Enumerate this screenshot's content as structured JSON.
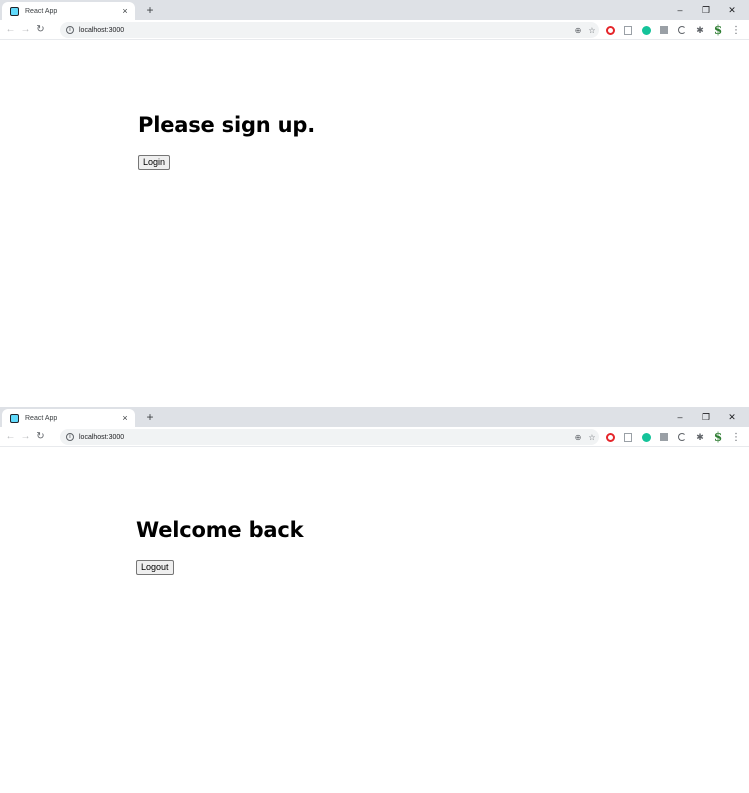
{
  "windows": [
    {
      "tab": {
        "title": "React App",
        "close_glyph": "×",
        "new_tab_glyph": "+"
      },
      "window_controls": {
        "minimize": "–",
        "restore": "❐",
        "close": "✕"
      },
      "address_bar": {
        "url": "localhost:3000"
      },
      "page": {
        "heading": "Please sign up.",
        "button_label": "Login"
      }
    },
    {
      "tab": {
        "title": "React App",
        "close_glyph": "×",
        "new_tab_glyph": "+"
      },
      "window_controls": {
        "minimize": "–",
        "restore": "❐",
        "close": "✕"
      },
      "address_bar": {
        "url": "localhost:3000"
      },
      "page": {
        "heading": "Welcome back",
        "button_label": "Logout"
      }
    }
  ],
  "icons": {
    "back": "back-arrow-icon",
    "forward": "forward-arrow-icon",
    "reload": "reload-icon",
    "site_info": "info-icon",
    "zoom": "zoom-icon",
    "bookmark": "star-icon",
    "extensions": [
      "opera-icon",
      "document-icon",
      "grammarly-icon",
      "square-extension-icon",
      "dark-mode-icon",
      "puzzle-icon",
      "dollar-icon",
      "kebab-menu-icon"
    ]
  },
  "colors": {
    "tabstrip": "#dee1e6",
    "omnibox": "#f1f3f4",
    "react_favicon": "#61dafb"
  }
}
